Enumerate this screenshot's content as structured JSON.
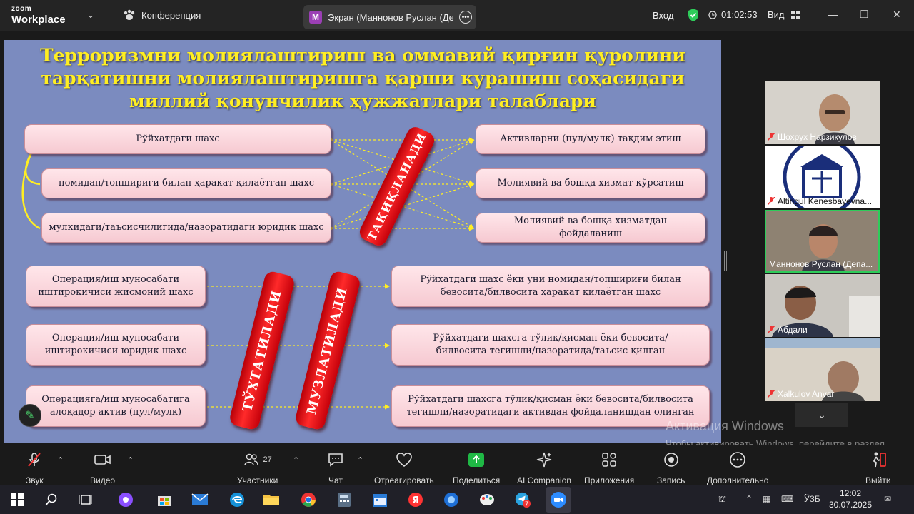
{
  "app": {
    "brand_small": "zoom",
    "brand_big": "Workplace",
    "conference_label": "Конференция",
    "tab_badge": "M",
    "tab_title": "Экран (Маннонов Руслан (Депар",
    "login_label": "Вход",
    "timer": "01:02:53",
    "view_label": "Вид"
  },
  "slide": {
    "title_lines": [
      "Терроризмни молиялаштириш ва оммавий қирғин қуролини",
      "тарқатишни молиялаштиришга қарши курашиш соҳасидаги",
      "миллий қонунчилик ҳужжатлари талаблари"
    ],
    "top_left": [
      "Рўйхатдаги шахс",
      "номидан/топшириғи билан ҳаракат қилаётган шахс",
      "мулкидаги/таъсисчилигида/назоратидаги юридик шахс"
    ],
    "top_right": [
      "Активларни (пул/мулк) тақдим этиш",
      "Молиявий ва бошқа хизмат кўрсатиш",
      "Молиявий ва бошқа хизматдан фойдаланиш"
    ],
    "bar_prohibited": "ТАҚИҚЛАНАДИ",
    "bottom_left": [
      [
        "Операция/иш муносабати",
        "иштирокичиси жисмоний шахс"
      ],
      [
        "Операция/иш муносабати",
        "иштирокичиси юридик шахс"
      ],
      [
        "Операцияга/иш муносабатига",
        "алоқадор актив (пул/мулк)"
      ]
    ],
    "bottom_right": [
      [
        "Рўйхатдаги шахс ёки уни номидан/топшириғи билан",
        "бевосита/билвосита ҳаракат қилаётган шахс"
      ],
      [
        "Рўйхатдаги шахсга тўлиқ/қисман ёки бевосита/",
        "билвосита тегишли/назоратида/таъсис қилган"
      ],
      [
        "Рўйхатдаги шахсга тўлиқ/қисман ёки бевосита/билвосита",
        "тегишли/назоратидаги активдан фойдаланишдан олинган"
      ]
    ],
    "bar_suspended": "ТЎХТАТИЛАДИ",
    "bar_frozen": "МУЗЛАТИЛАДИ"
  },
  "participants": [
    {
      "name": "Шохрух Нарзикулов",
      "muted": true
    },
    {
      "name": "Altingul Kenesbayevna...",
      "muted": true
    },
    {
      "name": "Маннонов Руслан (Депа...",
      "muted": false,
      "active": true
    },
    {
      "name": "Абдали",
      "muted": true
    },
    {
      "name": "Xalkulov Anvar",
      "muted": true
    }
  ],
  "watermark": {
    "line1": "Активация Windows",
    "line2": "Чтобы активировать Windows, перейдите в раздел \"Параметры\"."
  },
  "toolbar": {
    "audio": "Звук",
    "video": "Видео",
    "participants": "Участники",
    "participants_count": "27",
    "chat": "Чат",
    "react": "Отреагировать",
    "share": "Поделиться",
    "ai": "AI Companion",
    "apps": "Приложения",
    "record": "Запись",
    "more": "Дополнительно",
    "leave": "Выйти"
  },
  "taskbar": {
    "language": "ЎЗБ",
    "time": "12:02",
    "date": "30.07.2025",
    "telegram_badge": "7"
  },
  "colors": {
    "slide_bg": "#7b8bbf",
    "title": "#ffee22",
    "bar_red": "#e00010",
    "active_green": "#2ecc5a"
  }
}
